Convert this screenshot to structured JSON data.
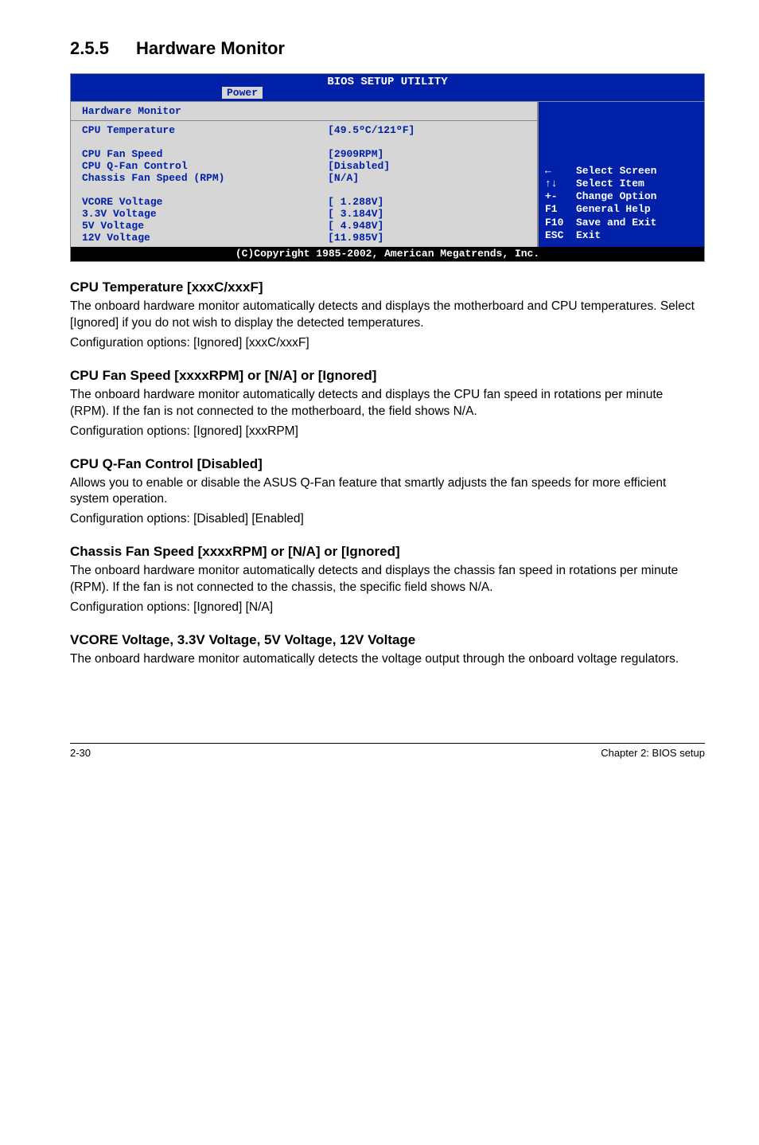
{
  "heading": {
    "number": "2.5.5",
    "title": "Hardware Monitor"
  },
  "bios": {
    "topTitle": "BIOS SETUP UTILITY",
    "tab": "Power",
    "panelTitle": "Hardware Monitor",
    "rows": [
      {
        "label": "CPU Temperature",
        "value": "[49.5ºC/121ºF]"
      },
      {
        "label": "",
        "value": ""
      },
      {
        "label": "CPU Fan Speed",
        "value": "[2909RPM]"
      },
      {
        "label": "CPU Q-Fan Control",
        "value": "[Disabled]"
      },
      {
        "label": "Chassis Fan Speed (RPM)",
        "value": "[N/A]"
      },
      {
        "label": "",
        "value": ""
      },
      {
        "label": "VCORE Voltage",
        "value": "[ 1.288V]"
      },
      {
        "label": "3.3V Voltage",
        "value": "[ 3.184V]"
      },
      {
        "label": "5V Voltage",
        "value": "[ 4.948V]"
      },
      {
        "label": "12V Voltage",
        "value": "[11.985V]"
      }
    ],
    "help": [
      {
        "key": "←",
        "text": "Select Screen"
      },
      {
        "key": "↑↓",
        "text": "Select Item"
      },
      {
        "key": "+-",
        "text": "Change Option"
      },
      {
        "key": "F1",
        "text": "General Help"
      },
      {
        "key": "F10",
        "text": "Save and Exit"
      },
      {
        "key": "ESC",
        "text": "Exit"
      }
    ],
    "footer": "(C)Copyright 1985-2002, American Megatrends, Inc."
  },
  "sections": [
    {
      "title": "CPU Temperature [xxxC/xxxF]",
      "paras": [
        "The onboard hardware monitor automatically detects and displays the motherboard and CPU temperatures. Select [Ignored] if you do not wish to display the detected temperatures.",
        "Configuration options: [Ignored] [xxxC/xxxF]"
      ]
    },
    {
      "title": "CPU Fan Speed [xxxxRPM] or [N/A] or [Ignored]",
      "paras": [
        "The onboard hardware monitor automatically detects and displays the CPU fan speed in rotations per minute (RPM). If the fan is not connected to the motherboard, the field shows N/A.",
        "Configuration options: [Ignored] [xxxRPM]"
      ]
    },
    {
      "title": "CPU Q-Fan Control [Disabled]",
      "paras": [
        "Allows you to enable or disable the ASUS Q-Fan feature that smartly adjusts the fan speeds for more efficient system operation.",
        "Configuration options: [Disabled] [Enabled]"
      ]
    },
    {
      "title": "Chassis Fan Speed [xxxxRPM] or [N/A] or [Ignored]",
      "paras": [
        "The onboard hardware monitor automatically detects and displays the chassis fan speed in rotations per minute (RPM). If the fan is not connected to the chassis, the specific field shows N/A.",
        "Configuration options: [Ignored] [N/A]"
      ]
    },
    {
      "title": "VCORE Voltage, 3.3V Voltage, 5V Voltage, 12V Voltage",
      "paras": [
        "The onboard hardware monitor automatically detects the voltage output through the onboard voltage regulators."
      ]
    }
  ],
  "pageFooter": {
    "left": "2-30",
    "right": "Chapter 2: BIOS setup"
  }
}
